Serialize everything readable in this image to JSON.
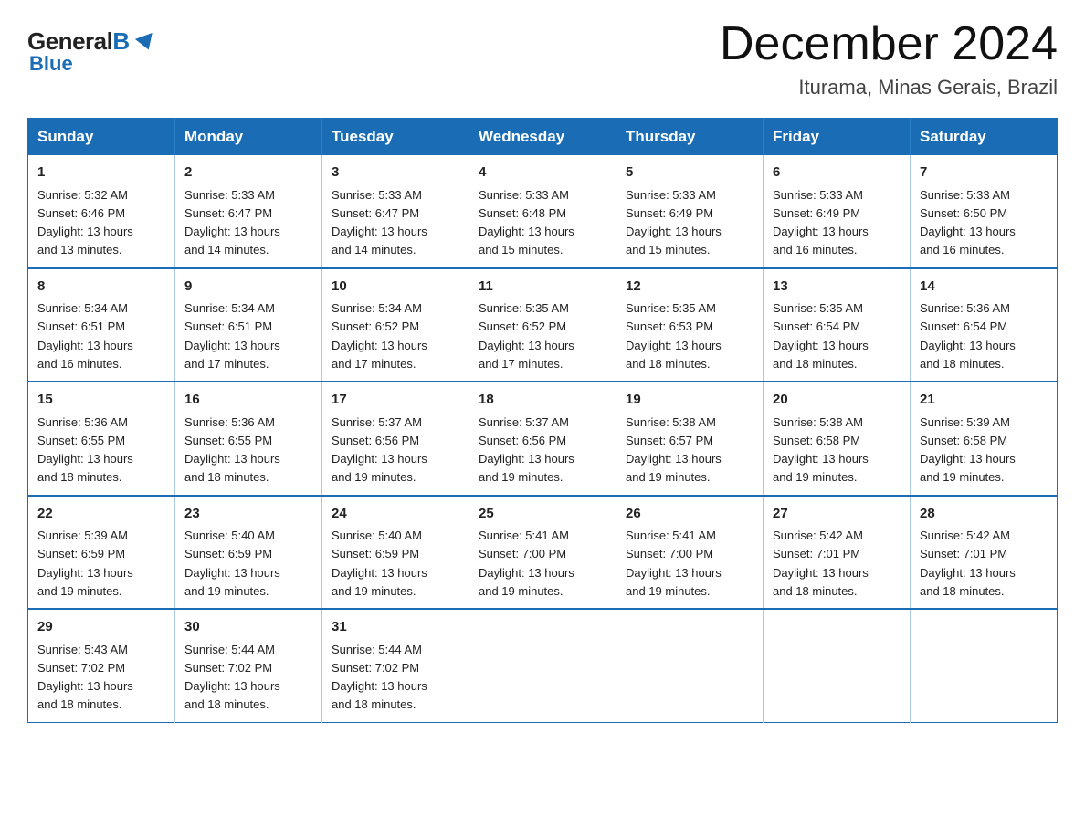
{
  "logo": {
    "general": "General",
    "blue": "Blue"
  },
  "title": "December 2024",
  "subtitle": "Iturama, Minas Gerais, Brazil",
  "days_of_week": [
    "Sunday",
    "Monday",
    "Tuesday",
    "Wednesday",
    "Thursday",
    "Friday",
    "Saturday"
  ],
  "weeks": [
    [
      {
        "day": "1",
        "sunrise": "5:32 AM",
        "sunset": "6:46 PM",
        "daylight": "13 hours and 13 minutes."
      },
      {
        "day": "2",
        "sunrise": "5:33 AM",
        "sunset": "6:47 PM",
        "daylight": "13 hours and 14 minutes."
      },
      {
        "day": "3",
        "sunrise": "5:33 AM",
        "sunset": "6:47 PM",
        "daylight": "13 hours and 14 minutes."
      },
      {
        "day": "4",
        "sunrise": "5:33 AM",
        "sunset": "6:48 PM",
        "daylight": "13 hours and 15 minutes."
      },
      {
        "day": "5",
        "sunrise": "5:33 AM",
        "sunset": "6:49 PM",
        "daylight": "13 hours and 15 minutes."
      },
      {
        "day": "6",
        "sunrise": "5:33 AM",
        "sunset": "6:49 PM",
        "daylight": "13 hours and 16 minutes."
      },
      {
        "day": "7",
        "sunrise": "5:33 AM",
        "sunset": "6:50 PM",
        "daylight": "13 hours and 16 minutes."
      }
    ],
    [
      {
        "day": "8",
        "sunrise": "5:34 AM",
        "sunset": "6:51 PM",
        "daylight": "13 hours and 16 minutes."
      },
      {
        "day": "9",
        "sunrise": "5:34 AM",
        "sunset": "6:51 PM",
        "daylight": "13 hours and 17 minutes."
      },
      {
        "day": "10",
        "sunrise": "5:34 AM",
        "sunset": "6:52 PM",
        "daylight": "13 hours and 17 minutes."
      },
      {
        "day": "11",
        "sunrise": "5:35 AM",
        "sunset": "6:52 PM",
        "daylight": "13 hours and 17 minutes."
      },
      {
        "day": "12",
        "sunrise": "5:35 AM",
        "sunset": "6:53 PM",
        "daylight": "13 hours and 18 minutes."
      },
      {
        "day": "13",
        "sunrise": "5:35 AM",
        "sunset": "6:54 PM",
        "daylight": "13 hours and 18 minutes."
      },
      {
        "day": "14",
        "sunrise": "5:36 AM",
        "sunset": "6:54 PM",
        "daylight": "13 hours and 18 minutes."
      }
    ],
    [
      {
        "day": "15",
        "sunrise": "5:36 AM",
        "sunset": "6:55 PM",
        "daylight": "13 hours and 18 minutes."
      },
      {
        "day": "16",
        "sunrise": "5:36 AM",
        "sunset": "6:55 PM",
        "daylight": "13 hours and 18 minutes."
      },
      {
        "day": "17",
        "sunrise": "5:37 AM",
        "sunset": "6:56 PM",
        "daylight": "13 hours and 19 minutes."
      },
      {
        "day": "18",
        "sunrise": "5:37 AM",
        "sunset": "6:56 PM",
        "daylight": "13 hours and 19 minutes."
      },
      {
        "day": "19",
        "sunrise": "5:38 AM",
        "sunset": "6:57 PM",
        "daylight": "13 hours and 19 minutes."
      },
      {
        "day": "20",
        "sunrise": "5:38 AM",
        "sunset": "6:58 PM",
        "daylight": "13 hours and 19 minutes."
      },
      {
        "day": "21",
        "sunrise": "5:39 AM",
        "sunset": "6:58 PM",
        "daylight": "13 hours and 19 minutes."
      }
    ],
    [
      {
        "day": "22",
        "sunrise": "5:39 AM",
        "sunset": "6:59 PM",
        "daylight": "13 hours and 19 minutes."
      },
      {
        "day": "23",
        "sunrise": "5:40 AM",
        "sunset": "6:59 PM",
        "daylight": "13 hours and 19 minutes."
      },
      {
        "day": "24",
        "sunrise": "5:40 AM",
        "sunset": "6:59 PM",
        "daylight": "13 hours and 19 minutes."
      },
      {
        "day": "25",
        "sunrise": "5:41 AM",
        "sunset": "7:00 PM",
        "daylight": "13 hours and 19 minutes."
      },
      {
        "day": "26",
        "sunrise": "5:41 AM",
        "sunset": "7:00 PM",
        "daylight": "13 hours and 19 minutes."
      },
      {
        "day": "27",
        "sunrise": "5:42 AM",
        "sunset": "7:01 PM",
        "daylight": "13 hours and 18 minutes."
      },
      {
        "day": "28",
        "sunrise": "5:42 AM",
        "sunset": "7:01 PM",
        "daylight": "13 hours and 18 minutes."
      }
    ],
    [
      {
        "day": "29",
        "sunrise": "5:43 AM",
        "sunset": "7:02 PM",
        "daylight": "13 hours and 18 minutes."
      },
      {
        "day": "30",
        "sunrise": "5:44 AM",
        "sunset": "7:02 PM",
        "daylight": "13 hours and 18 minutes."
      },
      {
        "day": "31",
        "sunrise": "5:44 AM",
        "sunset": "7:02 PM",
        "daylight": "13 hours and 18 minutes."
      },
      null,
      null,
      null,
      null
    ]
  ],
  "labels": {
    "sunrise": "Sunrise:",
    "sunset": "Sunset:",
    "daylight": "Daylight:"
  }
}
